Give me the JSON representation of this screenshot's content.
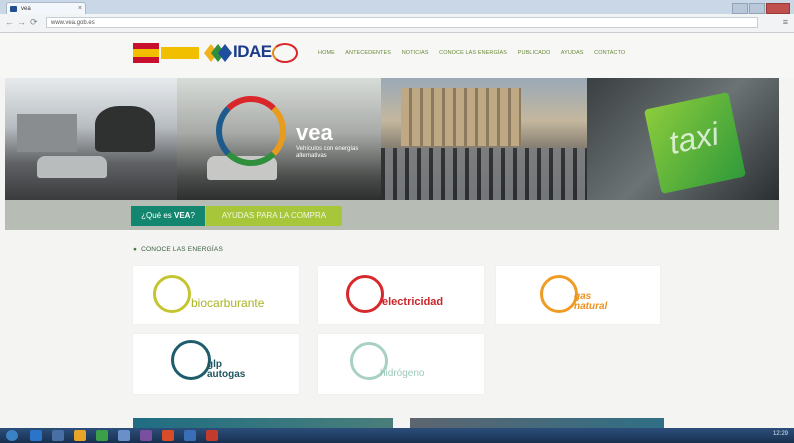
{
  "browser": {
    "tab_title": "vea",
    "url": "www.vea.gob.es"
  },
  "header": {
    "logo_text": "IDAE",
    "nav": [
      "HOME",
      "ANTECEDENTES",
      "NOTICIAS",
      "CONOCE LAS ENERGÍAS",
      "PUBLICADO",
      "AYUDAS",
      "CONTACTO"
    ]
  },
  "hero": {
    "brand": "vea",
    "tagline": "Vehículos con energías alternativas",
    "taxi_sign": "taxi"
  },
  "buttons": {
    "que_es_prefix": "¿Qué es ",
    "que_es_bold": "VEA",
    "que_es_suffix": "?",
    "ayudas": "AYUDAS PARA LA COMPRA"
  },
  "section": {
    "bullet": "●",
    "title": "CONOCE LAS ENERGÍAS"
  },
  "energies": {
    "biocarburante": "biocarburante",
    "electricidad": "electricidad",
    "gas_line1": "gas",
    "gas_line2": "natural",
    "glp_line1": "glp",
    "glp_line2": "autogas",
    "hidrogeno": "hidrógeno"
  },
  "tray": {
    "time": "12:29"
  },
  "colors": {
    "teal": "#12866f",
    "lime": "#a7c63a",
    "biocarburante": "#c5c531",
    "electricidad": "#d7282c",
    "gas": "#ef9b24",
    "glp": "#1f5d6b",
    "hidrogeno": "#a8d1c4"
  },
  "icons": [
    "back-icon",
    "forward-icon",
    "reload-icon",
    "menu-icon",
    "taxi-icon",
    "vea-logo-icon"
  ]
}
